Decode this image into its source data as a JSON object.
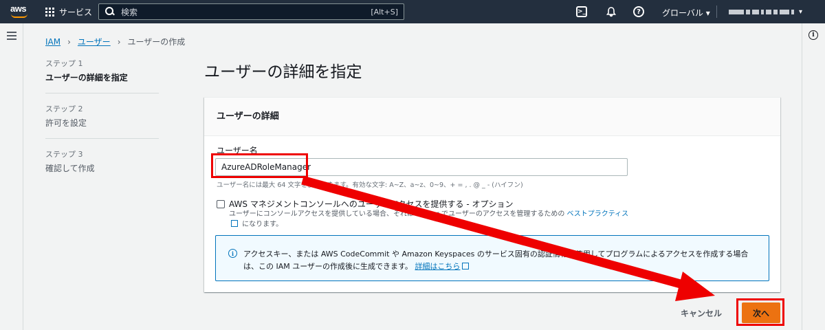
{
  "topnav": {
    "logo_text": "aws",
    "services_label": "サービス",
    "search_placeholder": "検索",
    "search_shortcut": "[Alt+S]",
    "region_label": "グローバル ▾"
  },
  "breadcrumb": {
    "items": [
      "IAM",
      "ユーザー",
      "ユーザーの作成"
    ]
  },
  "steps": [
    {
      "num": "ステップ 1",
      "label": "ユーザーの詳細を指定"
    },
    {
      "num": "ステップ 2",
      "label": "許可を設定"
    },
    {
      "num": "ステップ 3",
      "label": "確認して作成"
    }
  ],
  "page_title": "ユーザーの詳細を指定",
  "details": {
    "header": "ユーザーの詳細",
    "username_label": "ユーザー名",
    "username_value": "AzureADRoleManager",
    "constraint": "ユーザー名には最大 64 文字を使用できます。有効な文字: A~Z、a~z、0~9、+ = , . @ _ - (ハイフン)",
    "console_checkbox_label": "AWS マネジメントコンソールへのユーザーアクセスを提供する - オプション",
    "console_desc_prefix": "ユーザーにコンソールアクセスを提供している場合、それは Center でユーザーのアクセスを管理するための ",
    "console_desc_link": "ベストプラクティス",
    "console_desc_suffix": " になります。",
    "alert_text": "アクセスキー、または AWS CodeCommit や Amazon Keyspaces のサービス固有の認証情報を使用してプログラムによるアクセスを作成する場合は、この IAM ユーザーの作成後に生成できます。",
    "alert_link": "詳細はこちら"
  },
  "actions": {
    "cancel": "キャンセル",
    "next": "次へ"
  },
  "colors": {
    "nav_bg": "#232f3e",
    "primary": "#ec7211",
    "link": "#0073bb",
    "annotation": "#ee0000"
  }
}
